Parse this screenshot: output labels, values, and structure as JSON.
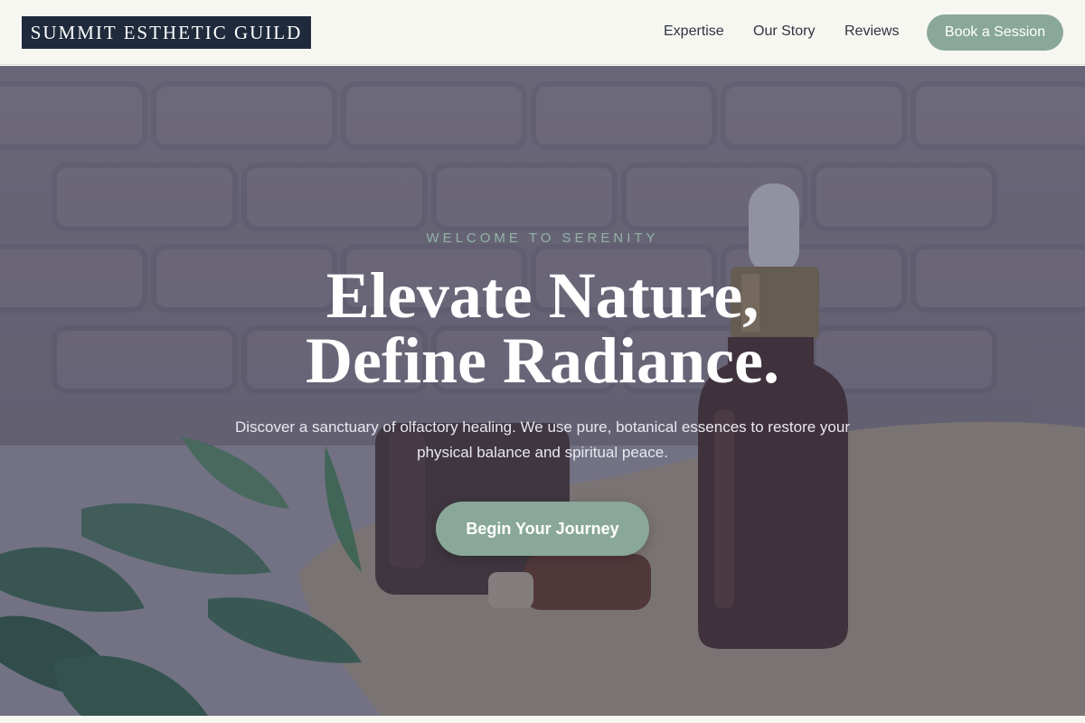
{
  "header": {
    "logo_text": "SUMMIT ESTHETIC GUILD",
    "nav": [
      {
        "label": "Expertise"
      },
      {
        "label": "Our Story"
      },
      {
        "label": "Reviews"
      }
    ],
    "cta_label": "Book a Session"
  },
  "hero": {
    "eyebrow": "WELCOME TO SERENITY",
    "headline_line1": "Elevate Nature,",
    "headline_line2": "Define Radiance.",
    "subtext": "Discover a sanctuary of olfactory healing. We use pure, botanical essences to restore your physical balance and spiritual peace.",
    "cta_label": "Begin Your Journey",
    "image_description_icons": [
      "dropper-bottle-icon",
      "amber-jar-icon",
      "leaf-icon",
      "burlap-cloth-icon"
    ]
  },
  "colors": {
    "brand_navy": "#1f2a3c",
    "sage_accent": "#8aa89a",
    "header_bg": "#f7f7f2",
    "eyebrow_text": "#93b3a6"
  }
}
